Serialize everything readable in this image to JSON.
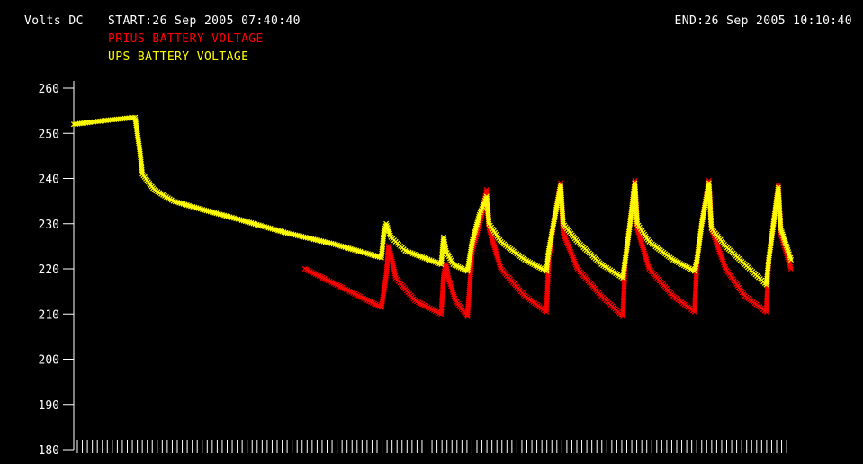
{
  "header": {
    "units_label": "Volts DC",
    "start_label": "START:26 Sep 2005 07:40:40",
    "end_label": "END:26 Sep 2005 10:10:40"
  },
  "colors": {
    "background": "#000000",
    "axis": "#ffffff",
    "prius": "#ff0000",
    "ups": "#ffff00"
  },
  "chart_data": {
    "type": "scatter",
    "x_unit": "time",
    "x_start": "26 Sep 2005 07:40:40",
    "x_end": "26 Sep 2005 10:10:40",
    "xlim": [
      "07:40:40",
      "10:10:40"
    ],
    "ylim": [
      180,
      260
    ],
    "yticks": [
      180,
      190,
      200,
      210,
      220,
      230,
      240,
      250,
      260
    ],
    "grid": false,
    "legend_position": "top-left",
    "marker": "x",
    "series": [
      {
        "name": "PRIUS BATTERY VOLTAGE",
        "color": "#ff0000",
        "points": [
          [
            "08:29:00",
            220.0
          ],
          [
            "08:45:00",
            211.5
          ],
          [
            "08:46:00",
            218.5
          ],
          [
            "08:46:30",
            225.0
          ],
          [
            "08:47:00",
            223.0
          ],
          [
            "08:48:00",
            218.0
          ],
          [
            "08:52:00",
            213.0
          ],
          [
            "08:57:30",
            210.0
          ],
          [
            "08:58:00",
            218.5
          ],
          [
            "08:58:30",
            221.0
          ],
          [
            "08:59:00",
            218.0
          ],
          [
            "09:00:30",
            213.0
          ],
          [
            "09:03:00",
            209.5
          ],
          [
            "09:04:00",
            224.0
          ],
          [
            "09:06:00",
            232.0
          ],
          [
            "09:07:00",
            237.5
          ],
          [
            "09:07:30",
            229.0
          ],
          [
            "09:10:00",
            220.0
          ],
          [
            "09:15:00",
            214.0
          ],
          [
            "09:19:30",
            210.5
          ],
          [
            "09:20:00",
            222.0
          ],
          [
            "09:21:00",
            230.0
          ],
          [
            "09:22:30",
            239.0
          ],
          [
            "09:23:00",
            228.0
          ],
          [
            "09:26:00",
            220.0
          ],
          [
            "09:31:00",
            214.0
          ],
          [
            "09:35:30",
            209.5
          ],
          [
            "09:36:00",
            222.0
          ],
          [
            "09:37:00",
            230.0
          ],
          [
            "09:38:00",
            239.5
          ],
          [
            "09:38:30",
            229.0
          ],
          [
            "09:41:00",
            220.0
          ],
          [
            "09:46:00",
            214.0
          ],
          [
            "09:50:30",
            210.5
          ],
          [
            "09:51:00",
            222.0
          ],
          [
            "09:52:00",
            230.0
          ],
          [
            "09:53:30",
            239.5
          ],
          [
            "09:54:00",
            229.0
          ],
          [
            "09:57:00",
            220.0
          ],
          [
            "10:01:00",
            214.0
          ],
          [
            "10:05:30",
            210.5
          ],
          [
            "10:06:00",
            222.0
          ],
          [
            "10:07:00",
            230.0
          ],
          [
            "10:08:00",
            238.5
          ],
          [
            "10:08:30",
            228.0
          ],
          [
            "10:10:40",
            220.0
          ]
        ]
      },
      {
        "name": "UPS BATTERY VOLTAGE",
        "color": "#ffff00",
        "points": [
          [
            "07:40:40",
            252.0
          ],
          [
            "07:47:00",
            252.8
          ],
          [
            "07:53:30",
            253.5
          ],
          [
            "07:54:30",
            246.0
          ],
          [
            "07:55:00",
            241.0
          ],
          [
            "07:57:30",
            237.5
          ],
          [
            "08:01:30",
            235.0
          ],
          [
            "08:08:00",
            233.0
          ],
          [
            "08:15:00",
            231.0
          ],
          [
            "08:25:00",
            228.0
          ],
          [
            "08:35:00",
            225.5
          ],
          [
            "08:45:00",
            222.5
          ],
          [
            "08:45:30",
            228.0
          ],
          [
            "08:46:00",
            230.0
          ],
          [
            "08:47:00",
            227.0
          ],
          [
            "08:50:00",
            224.0
          ],
          [
            "08:57:30",
            221.0
          ],
          [
            "08:58:00",
            227.0
          ],
          [
            "08:58:30",
            224.0
          ],
          [
            "09:00:00",
            221.0
          ],
          [
            "09:03:00",
            219.5
          ],
          [
            "09:04:00",
            226.0
          ],
          [
            "09:05:30",
            232.0
          ],
          [
            "09:07:00",
            236.0
          ],
          [
            "09:07:30",
            230.0
          ],
          [
            "09:10:00",
            226.0
          ],
          [
            "09:15:00",
            222.0
          ],
          [
            "09:19:30",
            219.5
          ],
          [
            "09:20:00",
            224.0
          ],
          [
            "09:21:00",
            230.0
          ],
          [
            "09:22:30",
            238.5
          ],
          [
            "09:23:00",
            230.0
          ],
          [
            "09:26:00",
            226.0
          ],
          [
            "09:31:00",
            221.0
          ],
          [
            "09:35:30",
            218.0
          ],
          [
            "09:36:00",
            222.0
          ],
          [
            "09:37:00",
            230.0
          ],
          [
            "09:38:00",
            239.0
          ],
          [
            "09:38:30",
            230.0
          ],
          [
            "09:41:00",
            226.0
          ],
          [
            "09:46:00",
            222.0
          ],
          [
            "09:50:30",
            219.5
          ],
          [
            "09:51:00",
            222.0
          ],
          [
            "09:52:00",
            230.0
          ],
          [
            "09:53:30",
            239.0
          ],
          [
            "09:54:00",
            229.0
          ],
          [
            "09:57:00",
            225.0
          ],
          [
            "10:01:00",
            221.0
          ],
          [
            "10:05:30",
            216.5
          ],
          [
            "10:06:00",
            222.0
          ],
          [
            "10:07:00",
            230.0
          ],
          [
            "10:08:00",
            238.0
          ],
          [
            "10:08:30",
            229.0
          ],
          [
            "10:10:40",
            222.0
          ]
        ]
      }
    ]
  }
}
